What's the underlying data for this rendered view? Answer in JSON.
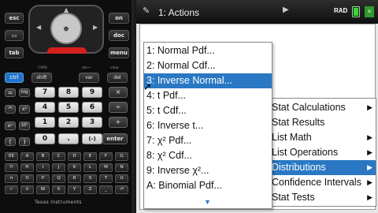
{
  "calculator": {
    "brand": "Texas Instruments",
    "keys": {
      "esc": "esc",
      "on": "on",
      "home_icon": "⌂",
      "doc": "doc",
      "tab": "tab",
      "menu": "menu",
      "ctrl": "ctrl",
      "shift": "shift",
      "var": "var",
      "del": "del",
      "caps": "CAPS",
      "sto": "sto→",
      "clear": "clear",
      "eq": "=",
      "trig": "trig",
      "hat": "^",
      "sq": "x²",
      "exp": "eˣ",
      "log": "10ˣ",
      "frac": "▭",
      "sqrt": "√",
      "pi": "π",
      "comma": ",",
      "ee": "EE",
      "flag": "?!▸",
      "n7": "7",
      "n8": "8",
      "n9": "9",
      "mul": "×",
      "n4": "4",
      "n5": "5",
      "n6": "6",
      "n1": "1",
      "n2": "2",
      "n3": "3",
      "minus": "-",
      "n0": "0",
      "dot": ".",
      "neg": "(-)",
      "enter": "enter",
      "div": "÷",
      "plus": "+",
      "lp": "(",
      "rp": ")"
    },
    "alpha_rows": [
      [
        "EE",
        "A",
        "B",
        "C",
        "D",
        "E",
        "F",
        "G"
      ],
      [
        "?!",
        "H",
        "I",
        "J",
        "K",
        "L",
        "M",
        "N"
      ],
      [
        "π",
        "O",
        "P",
        "Q",
        "R",
        "S",
        "T",
        "U"
      ],
      [
        "✓",
        "V",
        "W",
        "X",
        "Y",
        "Z",
        "_",
        "⏎"
      ]
    ]
  },
  "screen": {
    "title": "1: Actions",
    "mode": "RAD",
    "close": "×",
    "actions_menu": [
      {
        "label": "Stat Calculations",
        "arrow": "▶"
      },
      {
        "label": "Stat Results",
        "arrow": ""
      },
      {
        "label": "List Math",
        "arrow": "▶"
      },
      {
        "label": "List Operations",
        "arrow": "▶"
      },
      {
        "label": "Distributions",
        "arrow": "▶",
        "selected": true
      },
      {
        "label": "Confidence Intervals",
        "arrow": "▶"
      },
      {
        "label": "Stat Tests",
        "arrow": "▶"
      }
    ],
    "distributions_menu": [
      {
        "label": "1: Normal Pdf..."
      },
      {
        "label": "2: Normal Cdf..."
      },
      {
        "label": "3: Inverse Normal...",
        "selected": true
      },
      {
        "label": "4: t Pdf..."
      },
      {
        "label": "5: t Cdf..."
      },
      {
        "label": "6: Inverse t..."
      },
      {
        "label": "7: χ² Pdf..."
      },
      {
        "label": "8: χ² Cdf..."
      },
      {
        "label": "9: Inverse χ²..."
      },
      {
        "label": "A: Binomial Pdf..."
      }
    ],
    "scroll_indicator": "▼"
  },
  "colors": {
    "selection": "#2a78c4",
    "ctrl_key": "#1f74c9",
    "touchpad_bar": "#d41f1f"
  }
}
